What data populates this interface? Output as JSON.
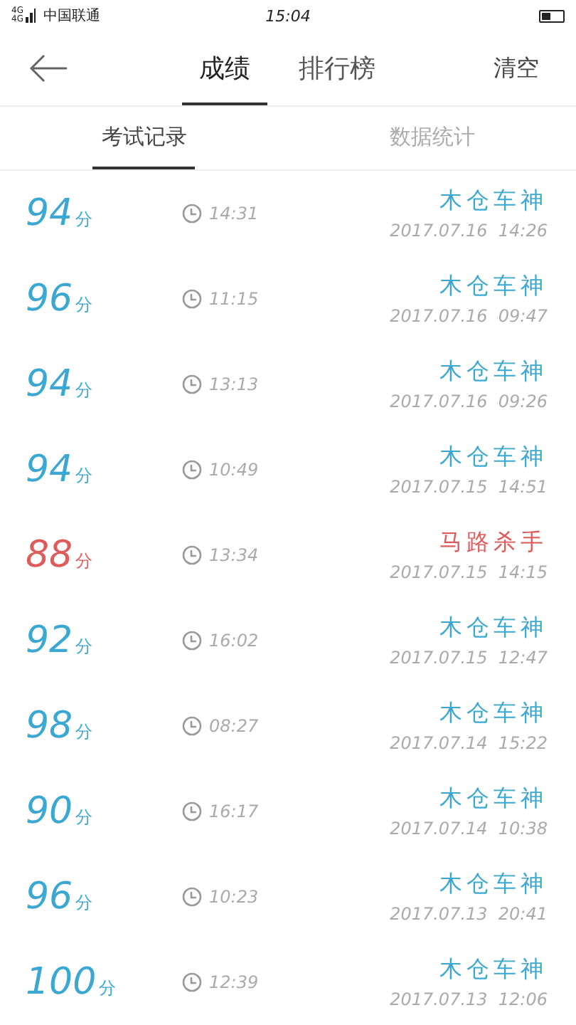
{
  "status_bar": {
    "network": [
      "4G",
      "4G"
    ],
    "carrier": "中国联通",
    "time": "15:04"
  },
  "header": {
    "tabs": [
      {
        "label": "成绩",
        "selected": true
      },
      {
        "label": "排行榜",
        "selected": false
      }
    ],
    "action": "清空"
  },
  "sub_tabs": [
    {
      "label": "考试记录",
      "selected": true
    },
    {
      "label": "数据统计",
      "selected": false
    }
  ],
  "records": [
    {
      "score": "94",
      "unit": "分",
      "duration": "14:31",
      "title": "木仓车神",
      "date": "2017.07.16  14:26",
      "color": "#3ba7d3"
    },
    {
      "score": "96",
      "unit": "分",
      "duration": "11:15",
      "title": "木仓车神",
      "date": "2017.07.16  09:47",
      "color": "#3ba7d3"
    },
    {
      "score": "94",
      "unit": "分",
      "duration": "13:13",
      "title": "木仓车神",
      "date": "2017.07.16  09:26",
      "color": "#3ba7d3"
    },
    {
      "score": "94",
      "unit": "分",
      "duration": "10:49",
      "title": "木仓车神",
      "date": "2017.07.15  14:51",
      "color": "#3ba7d3"
    },
    {
      "score": "88",
      "unit": "分",
      "duration": "13:34",
      "title": "马路杀手",
      "date": "2017.07.15  14:15",
      "color": "#de5b5b"
    },
    {
      "score": "92",
      "unit": "分",
      "duration": "16:02",
      "title": "木仓车神",
      "date": "2017.07.15  12:47",
      "color": "#3ba7d3"
    },
    {
      "score": "98",
      "unit": "分",
      "duration": "08:27",
      "title": "木仓车神",
      "date": "2017.07.14  15:22",
      "color": "#3ba7d3"
    },
    {
      "score": "90",
      "unit": "分",
      "duration": "16:17",
      "title": "木仓车神",
      "date": "2017.07.14  10:38",
      "color": "#3ba7d3"
    },
    {
      "score": "96",
      "unit": "分",
      "duration": "10:23",
      "title": "木仓车神",
      "date": "2017.07.13  20:41",
      "color": "#3ba7d3"
    },
    {
      "score": "100",
      "unit": "分",
      "duration": "12:39",
      "title": "木仓车神",
      "date": "2017.07.13  12:06",
      "color": "#3ba7d3"
    }
  ]
}
